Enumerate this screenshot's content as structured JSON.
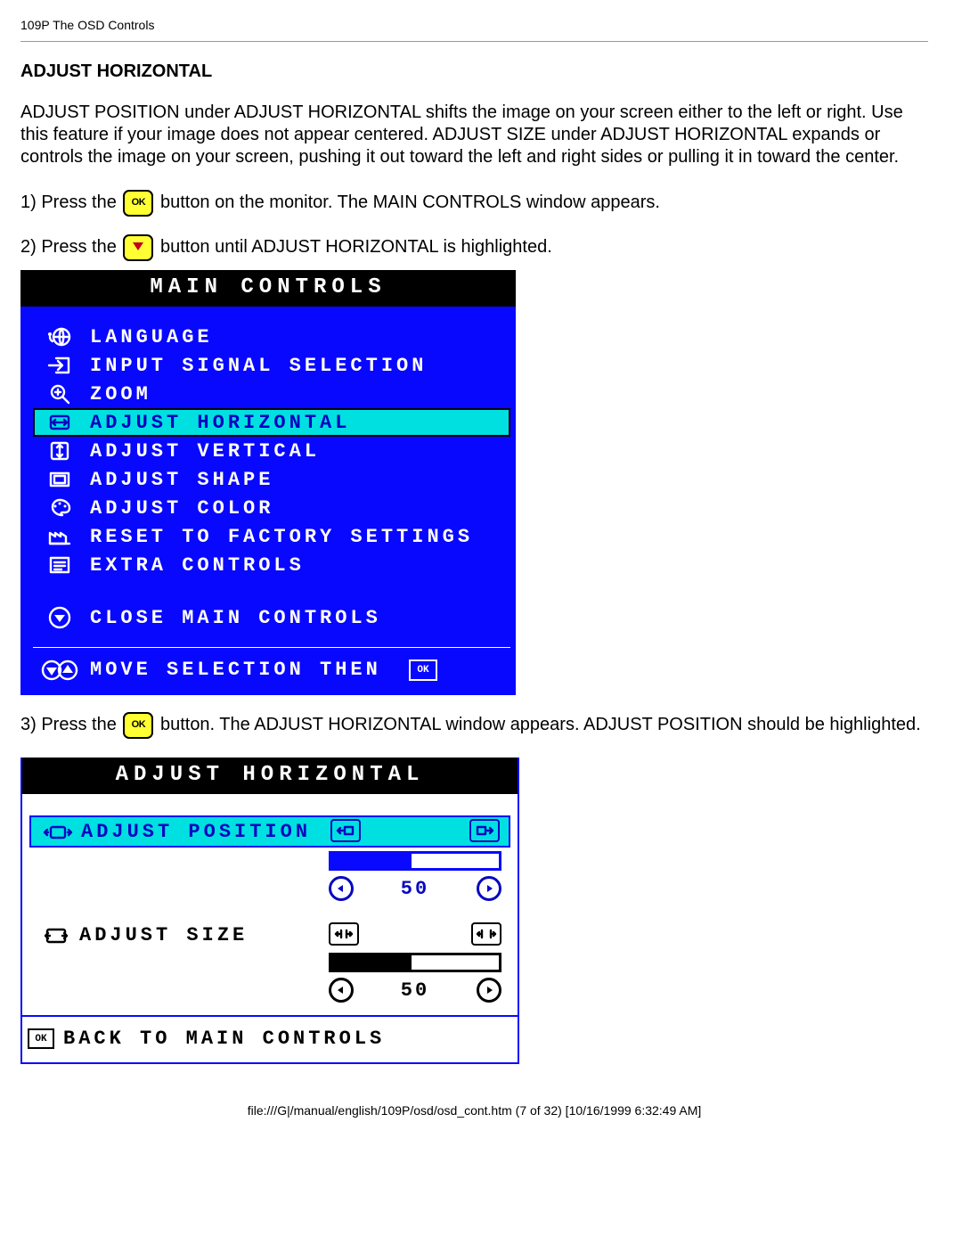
{
  "header": "109P The OSD Controls",
  "heading": "ADJUST HORIZONTAL",
  "intro": "ADJUST POSITION under ADJUST HORIZONTAL shifts the image on your screen either to the left or right. Use this feature if your image does not appear centered. ADJUST SIZE under ADJUST HORIZONTAL expands or controls the image on your screen, pushing it out toward the left and right sides or pulling it in toward the center.",
  "steps": {
    "s1_a": "1) Press the",
    "s1_b": "button on the monitor. The MAIN CONTROLS window appears.",
    "s2_a": "2) Press the",
    "s2_b": "button until ADJUST HORIZONTAL is highlighted.",
    "s3_a": "3) Press the",
    "s3_b": "button. The ADJUST HORIZONTAL window appears. ADJUST POSITION should be highlighted."
  },
  "osd1": {
    "title": "MAIN CONTROLS",
    "items": [
      {
        "label": "LANGUAGE",
        "icon": "globe"
      },
      {
        "label": "INPUT SIGNAL SELECTION",
        "icon": "input"
      },
      {
        "label": "ZOOM",
        "icon": "zoom"
      },
      {
        "label": "ADJUST HORIZONTAL",
        "icon": "horiz",
        "highlighted": true
      },
      {
        "label": "ADJUST VERTICAL",
        "icon": "vert"
      },
      {
        "label": "ADJUST SHAPE",
        "icon": "shape"
      },
      {
        "label": "ADJUST COLOR",
        "icon": "palette"
      },
      {
        "label": "RESET TO FACTORY SETTINGS",
        "icon": "reset"
      },
      {
        "label": "EXTRA CONTROLS",
        "icon": "list"
      }
    ],
    "close": "CLOSE MAIN CONTROLS",
    "footer": "MOVE SELECTION THEN",
    "footer_ok": "OK"
  },
  "osd2": {
    "title": "ADJUST HORIZONTAL",
    "pos_label": "ADJUST POSITION",
    "pos_value": "50",
    "size_label": "ADJUST SIZE",
    "size_value": "50",
    "back": "BACK TO MAIN CONTROLS",
    "back_ok": "OK"
  },
  "footer": "file:///G|/manual/english/109P/osd/osd_cont.htm (7 of 32) [10/16/1999 6:32:49 AM]"
}
